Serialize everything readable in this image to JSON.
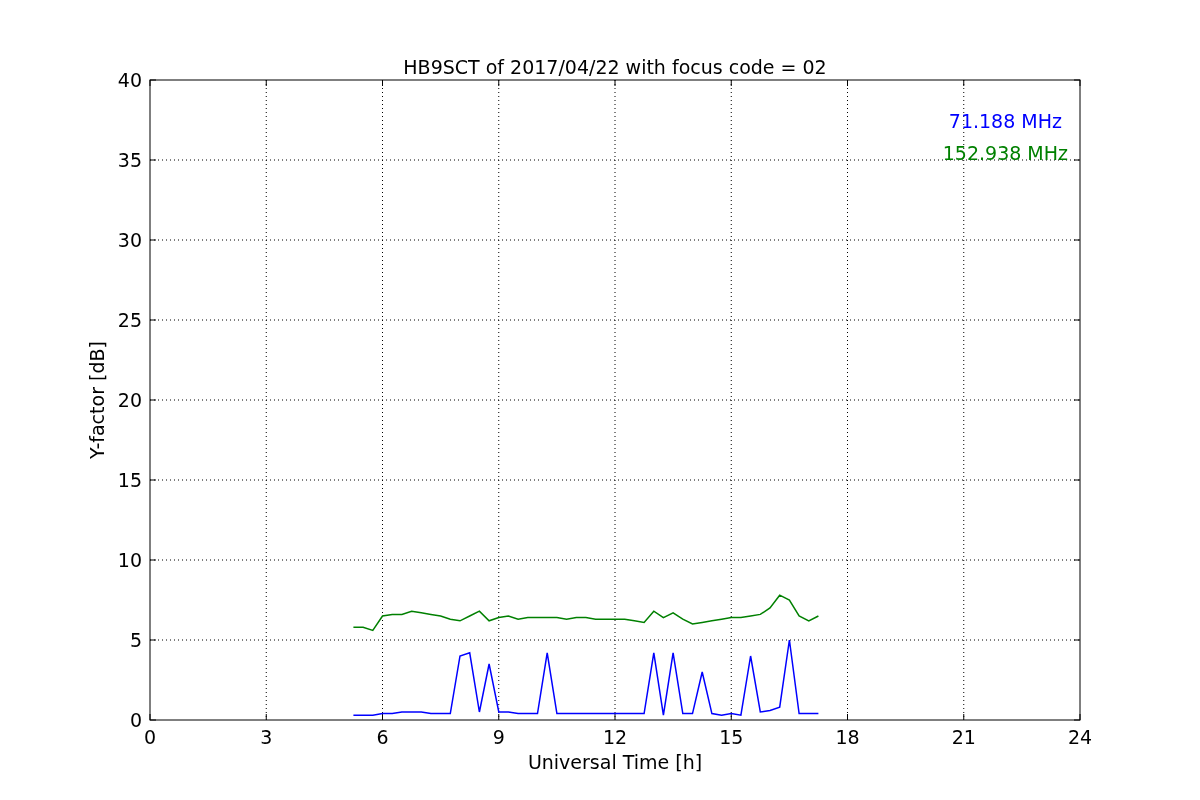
{
  "chart_data": {
    "type": "line",
    "title": "HB9SCT of 2017/04/22 with focus code = 02",
    "xlabel": "Universal Time [h]",
    "ylabel": "Y-factor [dB]",
    "x": [
      5.25,
      5.5,
      5.75,
      6.0,
      6.25,
      6.5,
      6.75,
      7.0,
      7.25,
      7.5,
      7.75,
      8.0,
      8.25,
      8.5,
      8.75,
      9.0,
      9.25,
      9.5,
      9.75,
      10.0,
      10.25,
      10.5,
      10.75,
      11.0,
      11.25,
      11.5,
      11.75,
      12.0,
      12.25,
      12.5,
      12.75,
      13.0,
      13.25,
      13.5,
      13.75,
      14.0,
      14.25,
      14.5,
      14.75,
      15.0,
      15.25,
      15.5,
      15.75,
      16.0,
      16.25,
      16.5,
      16.75,
      17.0,
      17.25
    ],
    "series": [
      {
        "name": "71.188 MHz",
        "color": "#0000ff",
        "values": [
          0.3,
          0.3,
          0.3,
          0.4,
          0.4,
          0.5,
          0.5,
          0.5,
          0.4,
          0.4,
          0.4,
          4.0,
          4.2,
          0.5,
          3.5,
          0.5,
          0.5,
          0.4,
          0.4,
          0.4,
          4.2,
          0.4,
          0.4,
          0.4,
          0.4,
          0.4,
          0.4,
          0.4,
          0.4,
          0.4,
          0.4,
          4.2,
          0.3,
          4.2,
          0.4,
          0.4,
          3.0,
          0.4,
          0.3,
          0.4,
          0.3,
          4.0,
          0.5,
          0.6,
          0.8,
          5.0,
          0.4,
          0.4,
          0.4
        ]
      },
      {
        "name": "152.938 MHz",
        "color": "#008000",
        "values": [
          5.8,
          5.8,
          5.6,
          6.5,
          6.6,
          6.6,
          6.8,
          6.7,
          6.6,
          6.5,
          6.3,
          6.2,
          6.5,
          6.8,
          6.2,
          6.4,
          6.5,
          6.3,
          6.4,
          6.4,
          6.4,
          6.4,
          6.3,
          6.4,
          6.4,
          6.3,
          6.3,
          6.3,
          6.3,
          6.2,
          6.1,
          6.8,
          6.4,
          6.7,
          6.3,
          6.0,
          6.1,
          6.2,
          6.3,
          6.4,
          6.4,
          6.5,
          6.6,
          7.0,
          7.8,
          7.5,
          6.5,
          6.2,
          6.5
        ]
      }
    ],
    "grid": true,
    "xlim": [
      0,
      24
    ],
    "ylim": [
      0,
      40
    ],
    "xticks": [
      0,
      3,
      6,
      9,
      12,
      15,
      18,
      21,
      24
    ],
    "yticks": [
      0,
      5,
      10,
      15,
      20,
      25,
      30,
      35,
      40
    ]
  }
}
